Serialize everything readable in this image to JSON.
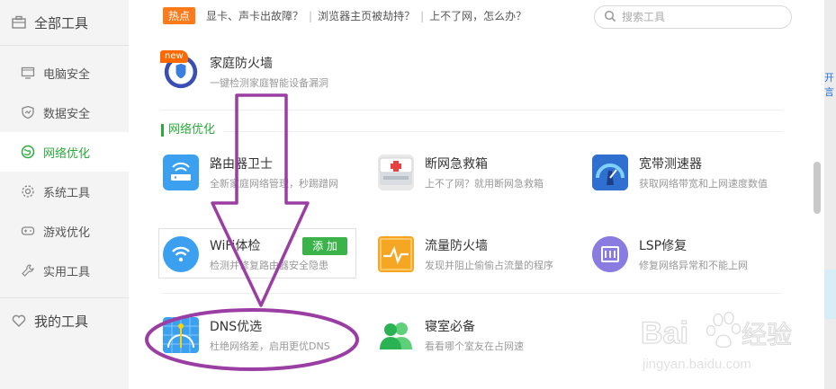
{
  "sidebar": {
    "all_tools": "全部工具",
    "items": [
      {
        "label": "电脑安全"
      },
      {
        "label": "数据安全"
      },
      {
        "label": "网络优化"
      },
      {
        "label": "系统工具"
      },
      {
        "label": "游戏优化"
      },
      {
        "label": "实用工具"
      }
    ],
    "my_tools": "我的工具"
  },
  "hotbar": {
    "badge": "热点",
    "links": [
      "显卡、声卡出故障？",
      "浏览器主页被劫持？",
      "上不了网，怎么办？"
    ],
    "sep": "|"
  },
  "search": {
    "placeholder": "搜索工具"
  },
  "new_badge": "new",
  "section_title": "网络优化",
  "tools": {
    "firewall": {
      "name": "家庭防火墙",
      "desc": "一键检测家庭智能设备漏洞"
    },
    "router": {
      "name": "路由器卫士",
      "desc": "全新家庭网络管理，秒踢蹭网"
    },
    "emergency": {
      "name": "断网急救箱",
      "desc": "上不了网？就用断网急救箱"
    },
    "speed": {
      "name": "宽带测速器",
      "desc": "获取网络带宽和上网速度数值"
    },
    "wifi": {
      "name": "WiFi体检",
      "desc": "检测并修复路由器安全隐患",
      "add": "添 加"
    },
    "flow": {
      "name": "流量防火墙",
      "desc": "发现并阻止偷偷占流量的程序"
    },
    "lsp": {
      "name": "LSP修复",
      "desc": "修复网络异常和不能上网"
    },
    "dns": {
      "name": "DNS优选",
      "desc": "杜绝网络差，启用更优DNS"
    },
    "dorm": {
      "name": "寝室必备",
      "desc": "看看哪个室友在占网速"
    }
  },
  "edge_text": "开言",
  "watermark": {
    "brand": "Bai",
    "cn": "经验",
    "url": "jingyan.baidu.com"
  },
  "colors": {
    "accent": "#2aaa3a",
    "hot": "#ff7a1a",
    "annotation": "#9b3ea3"
  }
}
